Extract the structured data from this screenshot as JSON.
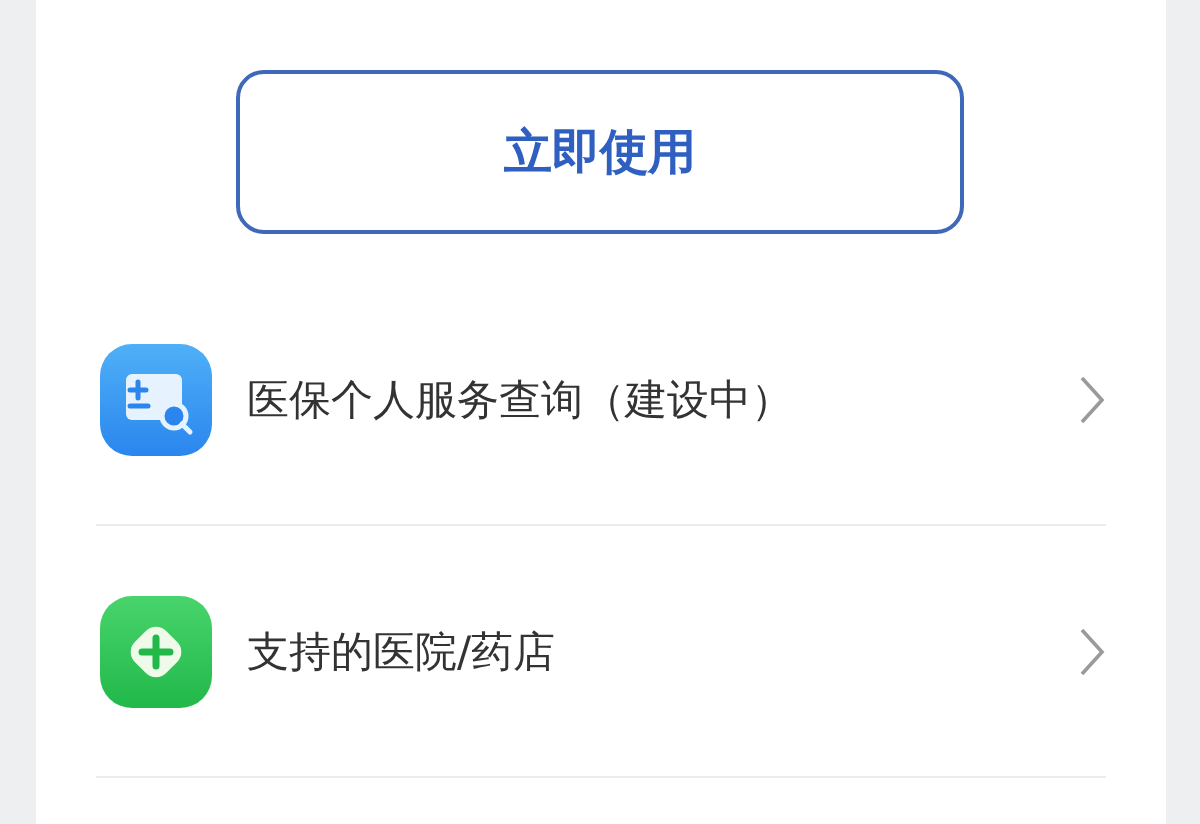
{
  "primary_button": {
    "label": "立即使用"
  },
  "menu_items": [
    {
      "kind": "query",
      "label": "医保个人服务查询（建设中）"
    },
    {
      "kind": "hospital",
      "label": "支持的医院/药店"
    }
  ]
}
